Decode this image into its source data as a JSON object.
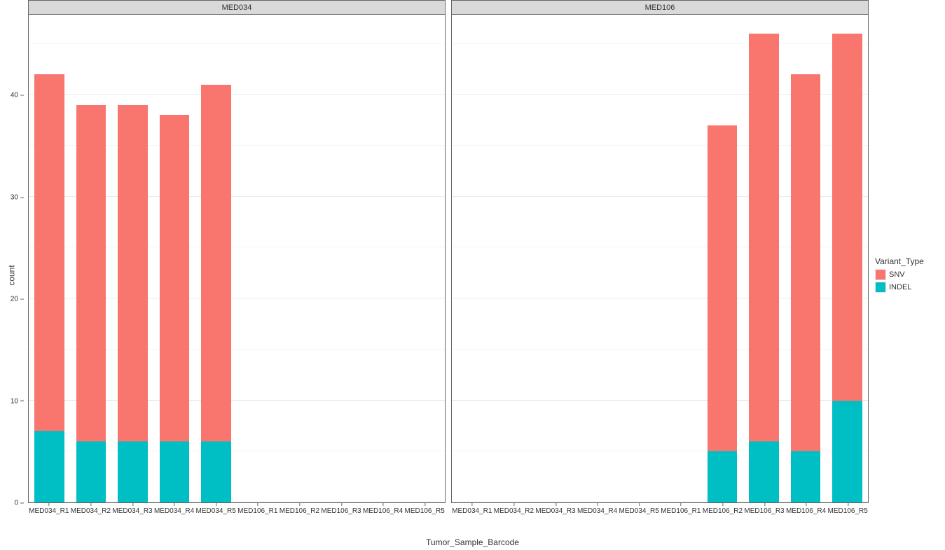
{
  "axes": {
    "y_title": "count",
    "x_title": "Tumor_Sample_Barcode",
    "y_ticks": [
      0,
      10,
      20,
      30,
      40
    ],
    "all_categories": [
      "MED034_R1",
      "MED034_R2",
      "MED034_R3",
      "MED034_R4",
      "MED034_R5",
      "MED106_R1",
      "MED106_R2",
      "MED106_R3",
      "MED106_R4",
      "MED106_R5"
    ]
  },
  "legend": {
    "title": "Variant_Type",
    "items": [
      {
        "name": "SNV",
        "color": "#f8766d"
      },
      {
        "name": "INDEL",
        "color": "#00bfc4"
      }
    ]
  },
  "panels": [
    {
      "facet": "MED034"
    },
    {
      "facet": "MED106"
    }
  ],
  "chart_data": {
    "type": "bar",
    "categories": [
      "MED034_R1",
      "MED034_R2",
      "MED034_R3",
      "MED034_R4",
      "MED034_R5",
      "MED106_R1",
      "MED106_R2",
      "MED106_R3",
      "MED106_R4",
      "MED106_R5"
    ],
    "series": [
      {
        "name": "INDEL",
        "values": [
          7,
          6,
          6,
          6,
          6,
          0,
          5,
          6,
          5,
          10
        ]
      },
      {
        "name": "SNV",
        "values": [
          35,
          33,
          33,
          32,
          35,
          0,
          32,
          40,
          37,
          36
        ]
      }
    ],
    "facet_by": [
      "MED034",
      "MED034",
      "MED034",
      "MED034",
      "MED034",
      "MED106",
      "MED106",
      "MED106",
      "MED106",
      "MED106"
    ],
    "xlabel": "Tumor_Sample_Barcode",
    "ylabel": "count",
    "ylim": [
      0,
      48
    ],
    "facets": [
      "MED034",
      "MED106"
    ]
  }
}
